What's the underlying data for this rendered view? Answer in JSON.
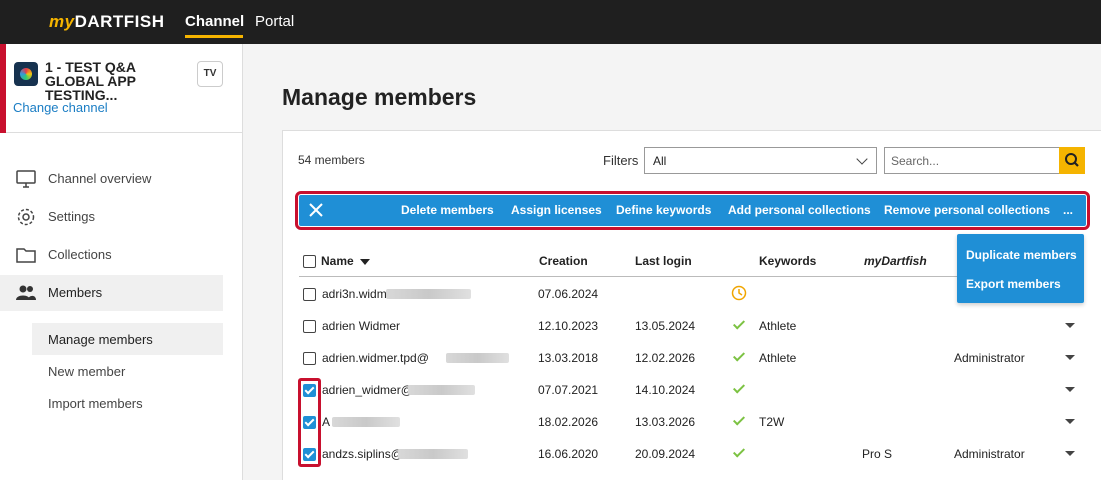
{
  "topbar": {
    "logo_prefix": "my",
    "logo_main": "DARTFISH",
    "nav": [
      "Channel",
      "Portal"
    ]
  },
  "sidebar": {
    "channel_title": "1 - TEST Q&A GLOBAL APP TESTING...",
    "tv_label": "TV",
    "change_channel": "Change channel",
    "items": [
      {
        "label": "Channel overview",
        "icon": "monitor-icon"
      },
      {
        "label": "Settings",
        "icon": "gear-icon"
      },
      {
        "label": "Collections",
        "icon": "folder-icon"
      },
      {
        "label": "Members",
        "icon": "users-icon"
      }
    ],
    "sub_items": [
      "Manage members",
      "New member",
      "Import members"
    ]
  },
  "main": {
    "title": "Manage members",
    "count": "54 members",
    "filters_label": "Filters",
    "filters_value": "All",
    "search_placeholder": "Search..."
  },
  "actions": [
    "Delete members",
    "Assign licenses",
    "Define keywords",
    "Add personal collections",
    "Remove personal collections",
    "..."
  ],
  "dropdown": [
    "Duplicate members",
    "Export members"
  ],
  "table": {
    "columns": [
      "Name",
      "Creation",
      "Last login",
      "Keywords",
      "myDartfish"
    ],
    "rows": [
      {
        "name": "adri3n.widm3r",
        "creation": "07.06.2024",
        "last_login": "",
        "keywords": "",
        "mydartfish": "",
        "role": "",
        "checked": false,
        "status": "pending"
      },
      {
        "name": "adrien Widmer",
        "creation": "12.10.2023",
        "last_login": "13.05.2024",
        "keywords": "Athlete",
        "mydartfish": "",
        "role": "",
        "checked": false,
        "status": "ok"
      },
      {
        "name": "adrien.widmer.tpd@",
        "creation": "13.03.2018",
        "last_login": "12.02.2026",
        "keywords": "Athlete",
        "mydartfish": "",
        "role": "Administrator",
        "checked": false,
        "status": "ok"
      },
      {
        "name": "adrien_widmer@",
        "creation": "07.07.2021",
        "last_login": "14.10.2024",
        "keywords": "",
        "mydartfish": "",
        "role": "",
        "checked": true,
        "status": "ok"
      },
      {
        "name": "A",
        "creation": "18.02.2026",
        "last_login": "13.03.2026",
        "keywords": "T2W",
        "mydartfish": "",
        "role": "",
        "checked": true,
        "status": "ok"
      },
      {
        "name": "andzs.siplins@",
        "creation": "16.06.2020",
        "last_login": "20.09.2024",
        "keywords": "",
        "mydartfish": "Pro S",
        "role": "Administrator",
        "checked": true,
        "status": "ok"
      }
    ]
  },
  "colors": {
    "accent": "#f5b400",
    "action_blue": "#1f8fd6",
    "highlight_red": "#c8102e",
    "ok_green": "#7cc242"
  }
}
